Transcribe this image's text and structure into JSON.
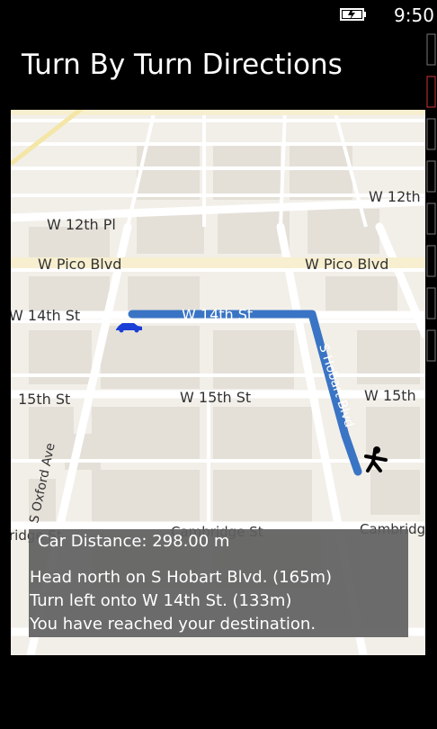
{
  "status_bar": {
    "time": "9:50",
    "battery_icon": "battery-charging-icon"
  },
  "page_title": "Turn By Turn Directions",
  "map": {
    "street_labels": {
      "w_12th_right": "W 12th",
      "w_12th_pl": "W 12th Pl",
      "w_pico_left": "W Pico Blvd",
      "w_pico_right": "W Pico Blvd",
      "w_14th_left": "W 14th St",
      "w_14th_route": "W 14th St",
      "s_hobart": "S Hobart Blvd",
      "15th_left": "15th St",
      "w_15th_mid": "W 15th St",
      "w_15th_right": "W 15th",
      "s_oxford": "S Oxford Ave",
      "cambridge_left": "ridge St",
      "cambridge_mid": "Cambridge St",
      "cambridge_right": "Cambridg"
    },
    "route_color": "#3a74c4",
    "car_color": "#1a3fd6",
    "icons": {
      "car": "car-icon",
      "walker": "pedestrian-icon"
    }
  },
  "directions_panel": {
    "car_distance": "Car Distance:  298.00 m",
    "steps": [
      "Head north on S Hobart Blvd. (165m)",
      "Turn left onto W 14th St. (133m)",
      "You have reached your destination."
    ]
  }
}
